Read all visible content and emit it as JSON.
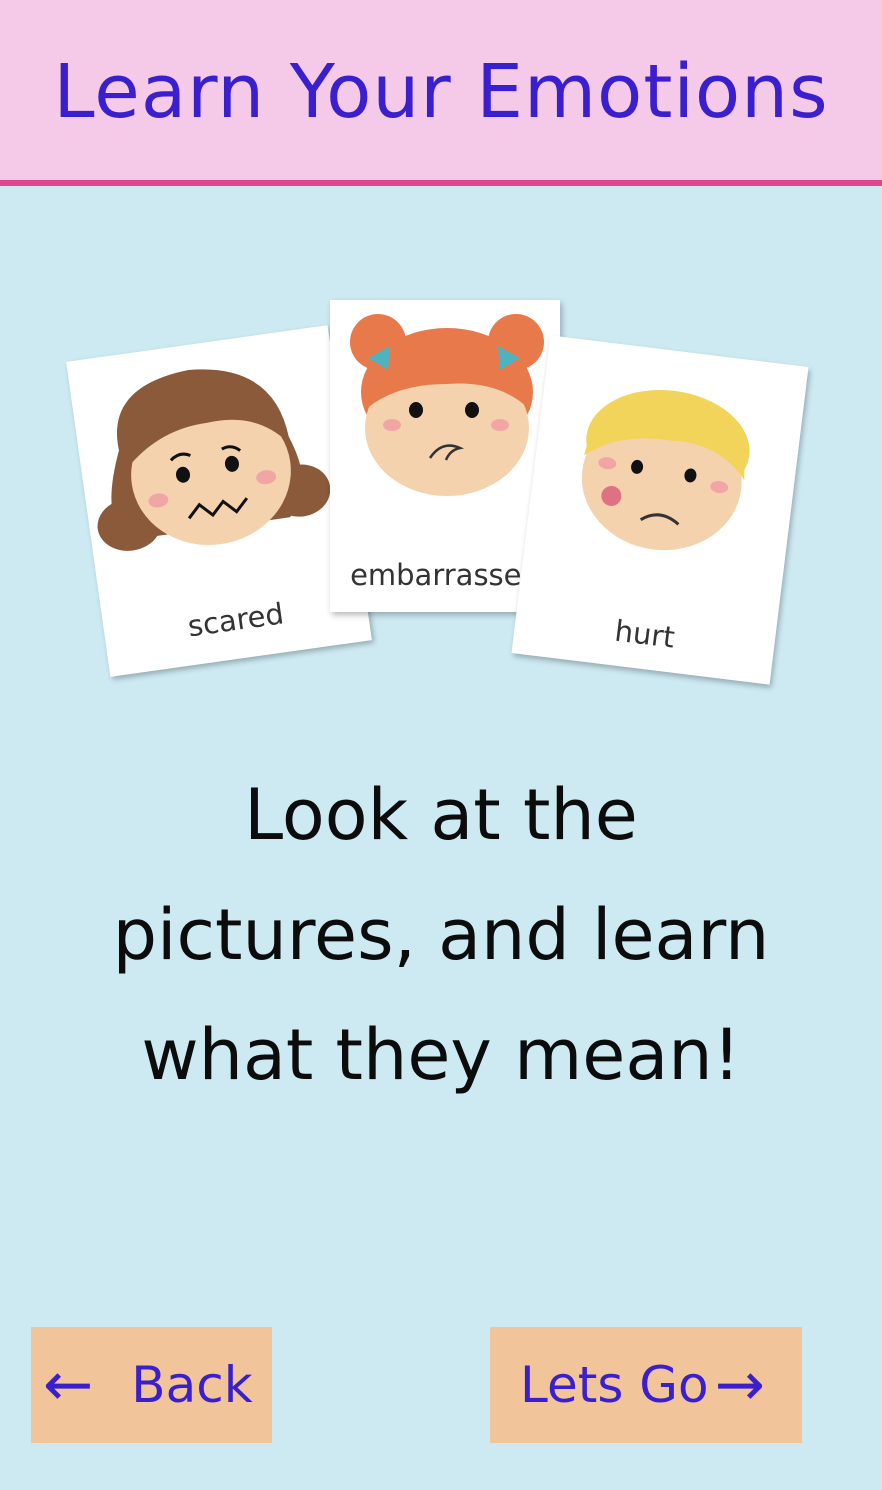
{
  "header": {
    "title": "Learn Your Emotions"
  },
  "cards": [
    {
      "label": "scared"
    },
    {
      "label": "embarrassed"
    },
    {
      "label": "hurt"
    }
  ],
  "instructions": {
    "line1": "Look at the",
    "line2": "pictures, and learn",
    "line3": "what they mean!"
  },
  "buttons": {
    "back_label": "Back",
    "back_arrow": "←",
    "go_label": "Lets Go",
    "go_arrow": "→"
  },
  "colors": {
    "header_bg": "#f5cae8",
    "header_border": "#e0458f",
    "page_bg": "#cdeaf3",
    "title_text": "#3a1fcf",
    "button_bg": "#f2c49a"
  }
}
